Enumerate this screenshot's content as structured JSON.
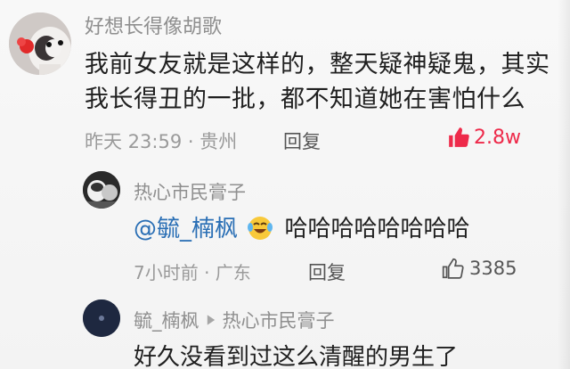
{
  "comments": [
    {
      "author": "好想长得像胡歌",
      "text_line1": "我前女友就是这样的，整天疑神疑鬼，其实",
      "text_line2": "我长得丑的一批，都不知道她在害怕什么",
      "meta": "昨天 23:59 · 贵州",
      "reply_label": "回复",
      "likes": "2.8w",
      "liked": true
    },
    {
      "author": "热心市民膏子",
      "mention": "@毓_楠枫",
      "text": "哈哈哈哈哈哈哈哈",
      "meta": "7小时前 · 广东",
      "reply_label": "回复",
      "likes": "3385",
      "liked": false
    },
    {
      "author": "毓_楠枫",
      "reply_to": "热心市民膏子",
      "text": "好久没看到过这么清醒的男生了"
    }
  ],
  "icons": {
    "like_filled": "thumb-up-filled-icon",
    "like_outline": "thumb-up-outline-icon",
    "reply_arrow": "triangle-right-icon",
    "emoji": "laughing-crying-emoji"
  },
  "colors": {
    "like_active": "#ee2a4a",
    "mention": "#2a6fb5",
    "meta": "#9a9a9a",
    "author": "#8f8f8f"
  }
}
